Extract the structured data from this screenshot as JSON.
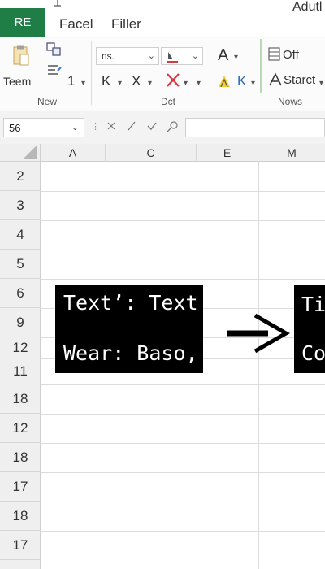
{
  "app": {
    "badge": "RE",
    "title": "Adutl"
  },
  "tabs": [
    {
      "label": "Facel"
    },
    {
      "label": "Filler"
    }
  ],
  "ribbon": {
    "groups": [
      {
        "label": "New"
      },
      {
        "label": "Dct"
      },
      {
        "label": "Nows"
      }
    ],
    "teem_label": "Teem",
    "font_name": "ns.",
    "number_1": "1",
    "k_label": "K",
    "x_label": "X",
    "font_letter": "A",
    "k2_label": "K",
    "off_label": "Off",
    "starct_label": "Starct"
  },
  "formula_bar": {
    "name_box": "56",
    "dots": "⋮",
    "formula": ""
  },
  "columns": [
    "A",
    "C",
    "E",
    "M"
  ],
  "rows": [
    "2",
    "3",
    "4",
    "5",
    "6",
    "9",
    "12",
    "11",
    "18",
    "12",
    "18",
    "17",
    "18",
    "17"
  ],
  "callout_left": {
    "line1": "Text’: Text",
    "line2": "Wear: Baso,"
  },
  "callout_right": {
    "line1": "Ti",
    "line2": "Co"
  },
  "colors": {
    "badge": "#1e7e45",
    "callout_bg": "#000000",
    "cross_red": "#d9363e",
    "highlight_green": "#b9dbb3"
  }
}
